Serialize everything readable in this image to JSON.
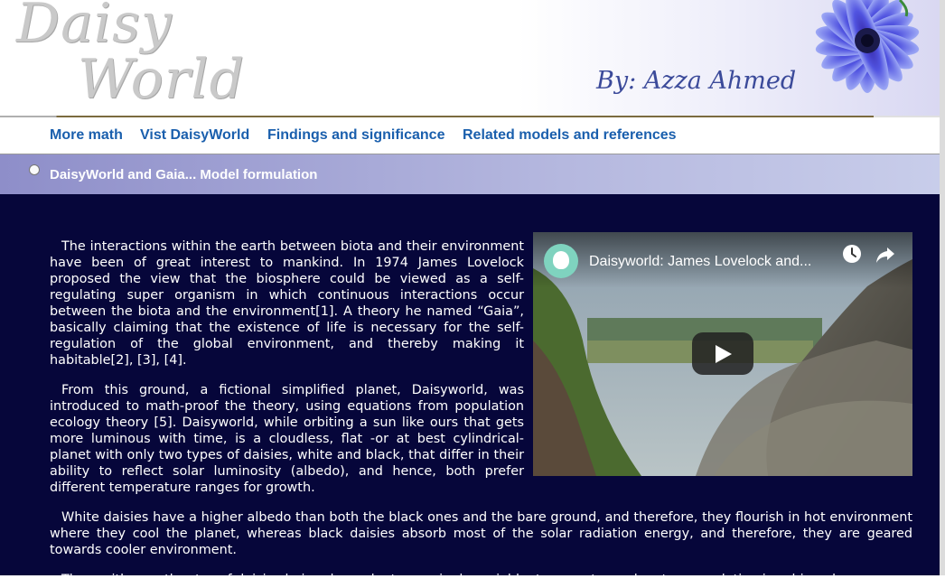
{
  "header": {
    "logo_line1": "Daisy",
    "logo_line2": "World",
    "byline": "By: Azza Ahmed"
  },
  "nav": {
    "items": [
      {
        "label": "More math"
      },
      {
        "label": "Vist DaisyWorld"
      },
      {
        "label": "Findings and significance"
      },
      {
        "label": "Related models and references"
      }
    ]
  },
  "subnav": {
    "label": "DaisyWorld and Gaia... Model formulation"
  },
  "content": {
    "paragraphs": [
      "The interactions within the earth between biota and their environment have been of great interest to mankind. In 1974 James Lovelock proposed the view that the biosphere could be viewed as a self-regulating super organism in which continuous interactions occur between the biota and the environment[1]. A theory he named “Gaia”, basically claiming that the existence of life is necessary for the self-regulation of the global environment, and thereby making it habitable[2], [3], [4].",
      "From this ground, a fictional simplified planet, Daisyworld, was introduced to math-proof the theory, using equations from population ecology theory [5]. Daisyworld, while orbiting a sun like ours that gets more luminous with time, is a cloudless, flat -or at best cylindrical- planet with only two types of daisies, white and black, that differ in their ability to reflect solar luminosity (albedo), and hence, both prefer different temperature ranges for growth.",
      "White daisies have a higher albedo than both the black ones and the bare ground, and therefore, they flourish in hot environment where they cool the planet, whereas black daisies absorb most of the solar radiation energy, and therefore, they are geared towards cooler environment.",
      "Thus, with growth rates of daisies being dependent on a single variable, temperature, planetary regulation is achieved,"
    ]
  },
  "video": {
    "title": "Daisyworld: James Lovelock and...",
    "icons": [
      "channel-avatar-icon",
      "watch-later-icon",
      "share-icon",
      "play-icon"
    ]
  },
  "colors": {
    "nav_link": "#1a5fad",
    "content_bg": "#06063a",
    "subnav_bg": "#8e8ec9",
    "byline": "#3b4a9a"
  }
}
